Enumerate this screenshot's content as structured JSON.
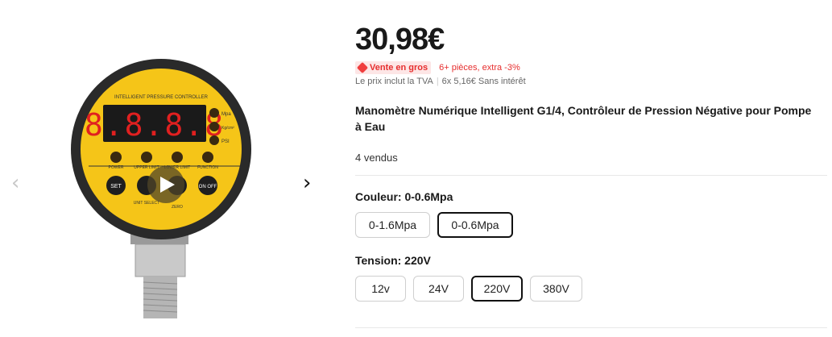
{
  "gallery": {
    "prev_icon": "chevron-left-icon",
    "next_icon": "chevron-right-icon",
    "video_icon": "play-icon",
    "gauge": {
      "header": "INTELLIGENT PRESSURE CONTROLLER",
      "display": "8.8.8.8",
      "units": [
        "Mpa",
        "Kg/cm²",
        "PSI"
      ],
      "labels": {
        "power": "POWER",
        "upper": "UPPER LIMIT",
        "lower": "LOWER LIMIT",
        "function": "FUNCTION",
        "set": "SET",
        "onoff": "ON OFF",
        "unit_select": "UNIT SELECT",
        "zero": "ZERO"
      }
    }
  },
  "product": {
    "price": "30,98€",
    "promo_badge": "Vente en gros",
    "promo_text": "6+ pièces, extra -3%",
    "vat_text": "Le prix inclut la TVA",
    "installments": "6x 5,16€ Sans intérêt",
    "title": "Manomètre Numérique Intelligent G1/4, Contrôleur de Pression Négative pour Pompe à Eau",
    "sold": "4 vendus"
  },
  "color_property": {
    "label": "Couleur: 0-0.6Mpa",
    "options": [
      "0-1.6Mpa",
      "0-0.6Mpa"
    ],
    "selected": "0-0.6Mpa"
  },
  "voltage_property": {
    "label": "Tension: 220V",
    "options": [
      "12v",
      "24V",
      "220V",
      "380V"
    ],
    "selected": "220V"
  },
  "colors": {
    "price_text": "#191919",
    "promo_red": "#e62e2e",
    "gauge_yellow": "#f5c518"
  }
}
